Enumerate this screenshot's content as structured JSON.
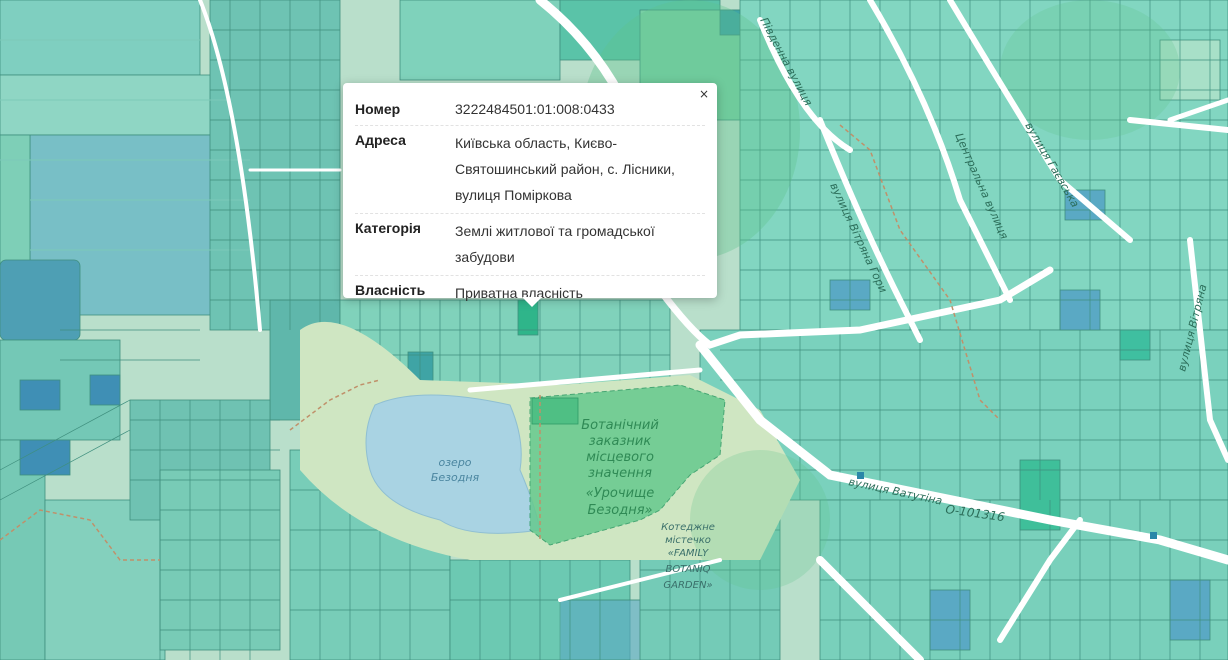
{
  "map": {
    "labels": {
      "street_pivdenna": "Південна вулиця",
      "street_tsentralna": "Центральна вулиця",
      "street_haievska": "вулиця Гаєвська",
      "street_vitriana_mid": "вулиця Вітряна Гори",
      "street_vitriana_right": "вулиця Вітряна",
      "street_vatutina": "вулиця Ватутіна",
      "road_code": "О-101316",
      "lake_line1": "озеро",
      "lake_line2": "Безодня",
      "reserve_line1": "Ботанічний",
      "reserve_line2": "заказник",
      "reserve_line3": "місцевого",
      "reserve_line4": "значення",
      "reserve_line5": "«Урочище",
      "reserve_line6": "Безодня»",
      "cottage_line1": "Котеджне",
      "cottage_line2": "містечко",
      "cottage_line3": "«FAMILY",
      "cottage_line4": "BOTANIQ",
      "cottage_line5": "GARDEN»"
    },
    "colors": {
      "background": "#b9dfcb",
      "parcel_residential": "#6fcfb1",
      "parcel_agri": "#8fdcb8",
      "parcel_dark": "#4fb7a8",
      "parcel_blue": "#5aa9c4",
      "road": "#ffffff",
      "water": "#a9d3e3",
      "reserve": "#66c98e",
      "selected_parcel": "#2fb58a"
    }
  },
  "popup": {
    "close_label": "×",
    "rows": [
      {
        "key": "Номер",
        "value": "3222484501:01:008:0433"
      },
      {
        "key": "Адреса",
        "value": "Київська область, Києво-Святошинський район, с. Лісники, вулиця Поміркова"
      },
      {
        "key": "Категорія",
        "value": "Землі житлової та громадської забудови"
      },
      {
        "key": "Власність",
        "value": "Приватна власність"
      }
    ]
  }
}
